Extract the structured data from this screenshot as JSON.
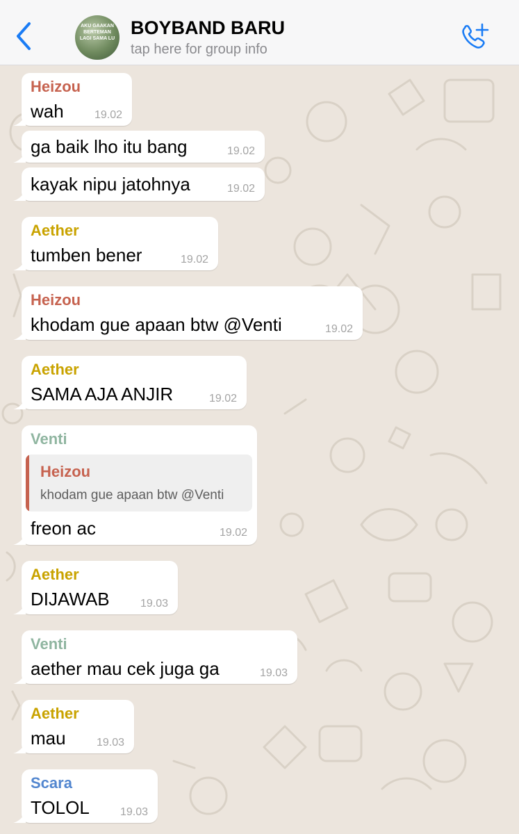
{
  "header": {
    "title": "BOYBAND BARU",
    "subtitle": "tap here for group info",
    "avatar_text": "AKU GAAKAN BERTEMAN LAGI SAMA LU",
    "back_icon": "chevron-left-icon",
    "call_icon": "phone-add-icon"
  },
  "colors": {
    "accent": "#1a7cf5",
    "background": "#ece5dd",
    "bubble": "#ffffff",
    "timestamp": "#a4a4a4",
    "sender_heizou": "#c6624f",
    "sender_aether": "#c9a300",
    "sender_venti": "#8fb5a0",
    "sender_scara": "#5286cf"
  },
  "messages": [
    {
      "sender": "Heizou",
      "text": "wah",
      "time": "19.02"
    },
    {
      "sender": "",
      "text": "ga baik lho itu bang",
      "time": "19.02"
    },
    {
      "sender": "",
      "text": "kayak nipu jatohnya",
      "time": "19.02"
    },
    {
      "sender": "Aether",
      "text": "tumben bener",
      "time": "19.02"
    },
    {
      "sender": "Heizou",
      "text": "khodam gue apaan btw @Venti",
      "time": "19.02"
    },
    {
      "sender": "Aether",
      "text": "SAMA AJA ANJIR",
      "time": "19.02"
    },
    {
      "sender": "Venti",
      "text": "freon ac",
      "time": "19.02",
      "reply": {
        "sender": "Heizou",
        "text": "khodam gue apaan btw @Venti"
      }
    },
    {
      "sender": "Aether",
      "text": "DIJAWAB",
      "time": "19.03"
    },
    {
      "sender": "Venti",
      "text": "aether mau cek juga ga",
      "time": "19.03"
    },
    {
      "sender": "Aether",
      "text": "mau",
      "time": "19.03"
    },
    {
      "sender": "Scara",
      "text": "TOLOL",
      "time": "19.03"
    }
  ]
}
